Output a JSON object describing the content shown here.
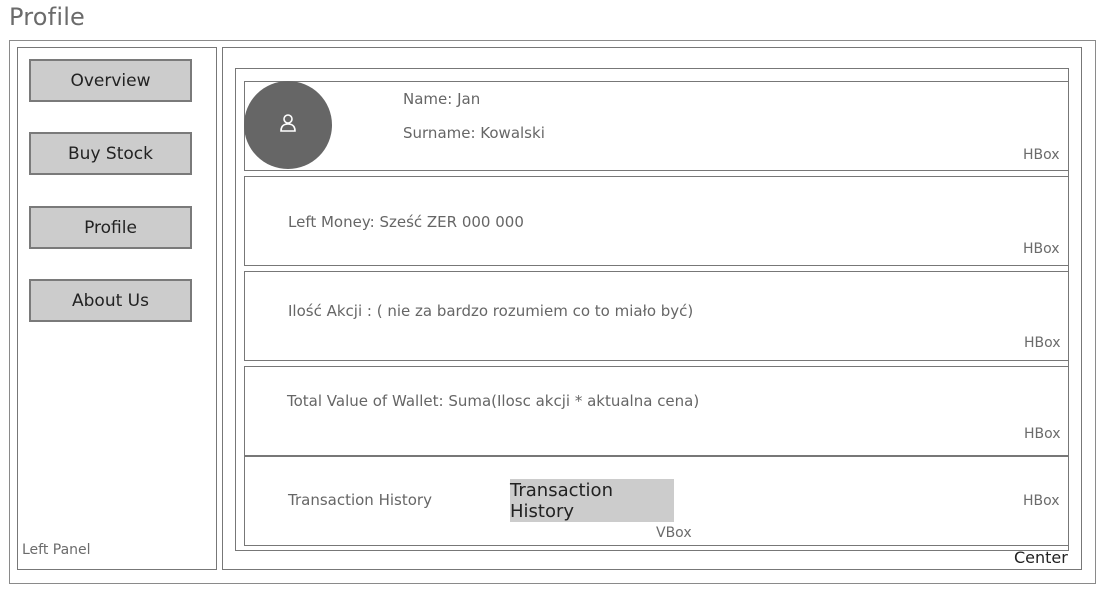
{
  "page": {
    "title": "Profile"
  },
  "left_panel": {
    "label": "Left Panel",
    "buttons": [
      {
        "label": "Overview"
      },
      {
        "label": "Buy Stock"
      },
      {
        "label": "Profile"
      },
      {
        "label": "About Us"
      }
    ]
  },
  "center": {
    "label": "Center",
    "vbox_label": "VBox",
    "hbox_label": "HBox",
    "user": {
      "name": "Name: Jan",
      "surname": "Surname: Kowalski",
      "avatar_icon": "user-icon"
    },
    "left_money": "Left Money: Sześć ZER 000 000",
    "stock_count": "Ilość Akcji : ( nie za bardzo rozumiem co to miało być)",
    "total_value": "Total Value of Wallet: Suma(Ilosc akcji * aktualna cena)",
    "transaction_history": {
      "label": "Transaction History",
      "button_label": "Transaction History"
    }
  }
}
